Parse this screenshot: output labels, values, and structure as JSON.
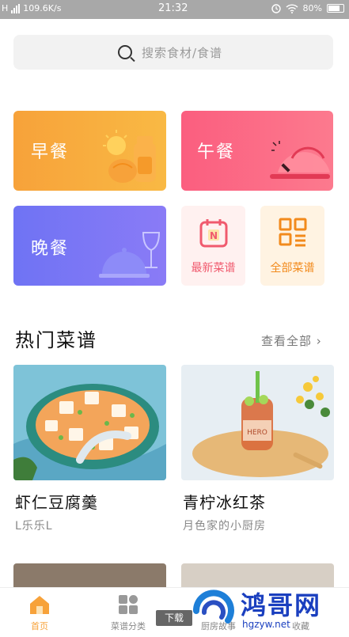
{
  "status_bar": {
    "network": "H",
    "speed": "109.6K/s",
    "time": "21:32",
    "battery": "80%"
  },
  "search": {
    "placeholder": "搜索食材/食谱"
  },
  "categories": {
    "breakfast": "早餐",
    "lunch": "午餐",
    "dinner": "晚餐",
    "new_recipes": "最新菜谱",
    "all_recipes": "全部菜谱"
  },
  "hot": {
    "title": "热门菜谱",
    "view_all": "查看全部 ›",
    "recipes": [
      {
        "title": "虾仁豆腐羹",
        "author": "L乐乐L"
      },
      {
        "title": "青柠冰红茶",
        "author": "月色家的小厨房"
      }
    ]
  },
  "tabbar": {
    "items": [
      {
        "label": "首页",
        "icon": "home-icon"
      },
      {
        "label": "菜谱分类",
        "icon": "category-icon"
      },
      {
        "label": "厨房故事",
        "icon": "kitchen-icon"
      },
      {
        "label": "收藏",
        "icon": "favorite-icon"
      }
    ],
    "active_color": "#f7a23a",
    "download_label": "下载"
  },
  "watermark": {
    "brand": "鸿哥网",
    "url": "hgzyw.net"
  },
  "colors": {
    "breakfast": "#f7a23a",
    "lunch": "#fb5e7f",
    "dinner": "#6f73f4",
    "new_recipes_text": "#f05a6e",
    "all_recipes_text": "#f28a1c"
  }
}
